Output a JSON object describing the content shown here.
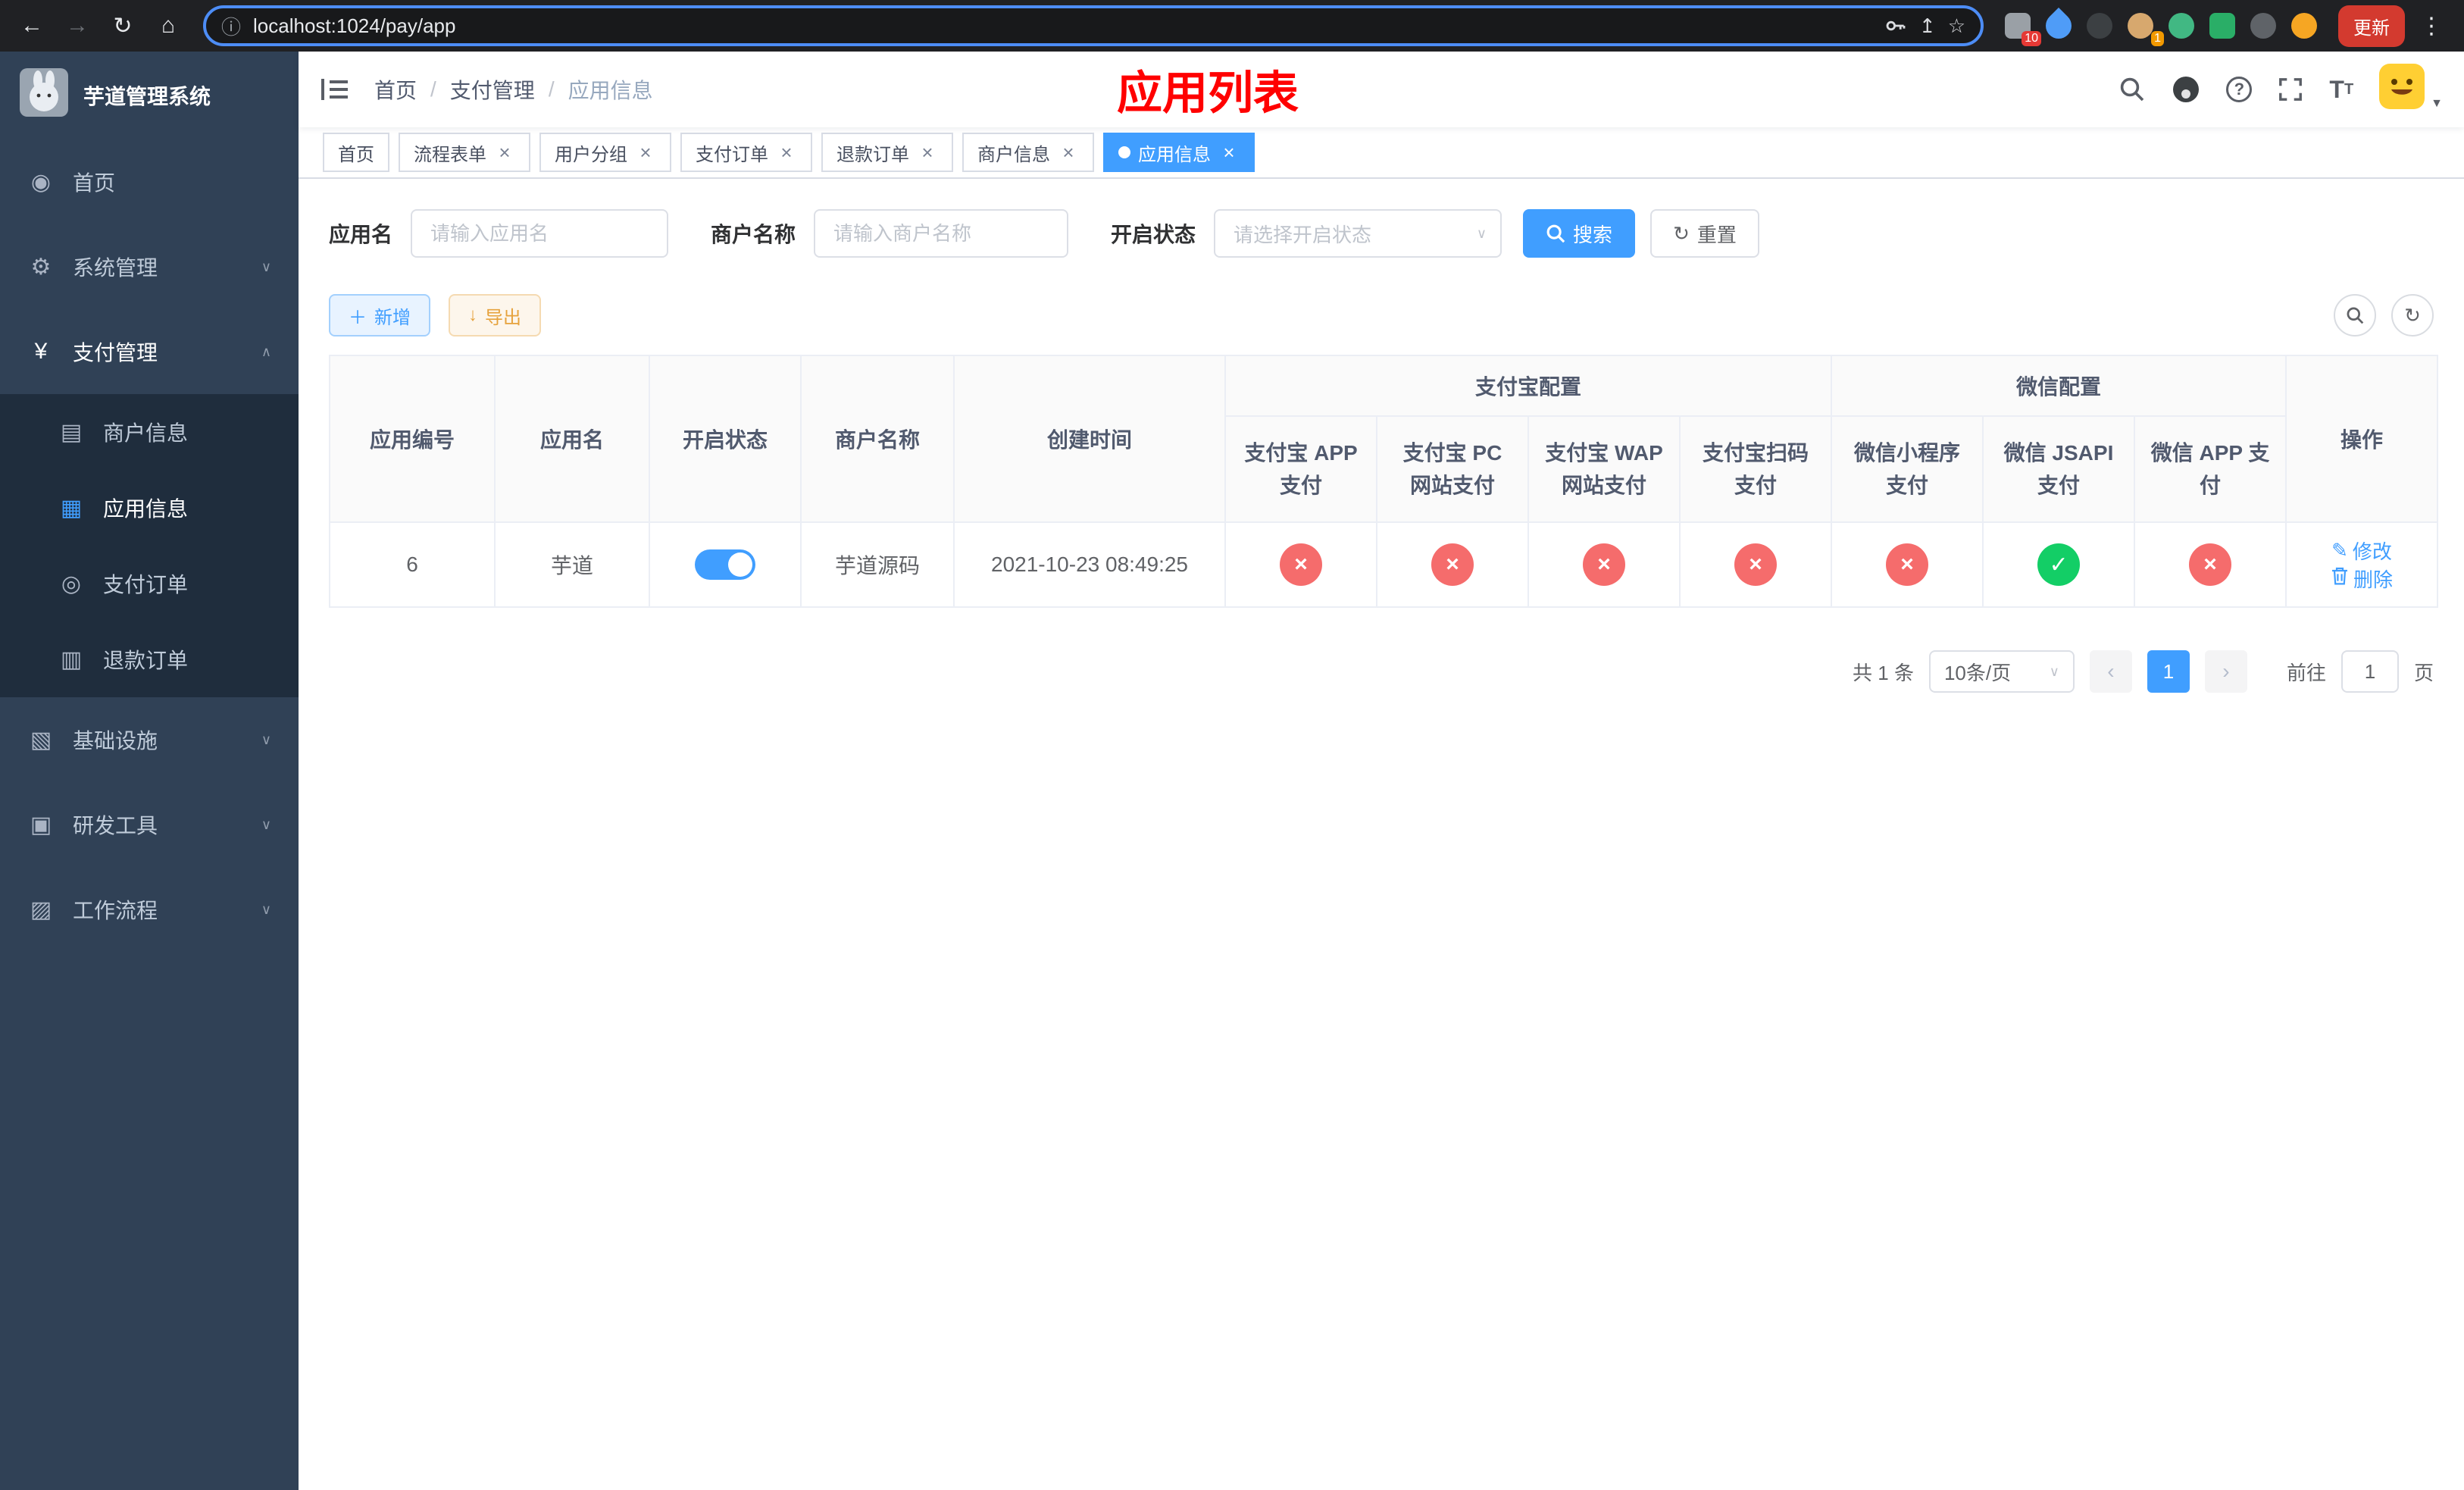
{
  "colors": {
    "accent": "#409eff",
    "danger": "#f56c6c",
    "success": "#13ce66",
    "warning": "#e6a23c",
    "sidebar-bg": "#304156",
    "submenu-bg": "#1f2d3d",
    "sidebar-text": "#bfcbd9",
    "update-red": "#d33a2f",
    "title-red": "#ff0000"
  },
  "icons": {
    "cross": "×",
    "check": "✓",
    "edit": "✎",
    "chevron_down": "∨",
    "chevron_up": "∧"
  },
  "browser": {
    "url": "localhost:1024/pay/app",
    "update_label": "更新",
    "extensions": [
      {
        "name": "grid-extension-icon",
        "shape": "square",
        "color": "#9aa0a6",
        "badge": "10",
        "badgeColor": "#e53935"
      },
      {
        "name": "drop-extension-icon",
        "shape": "drop",
        "color": "#4f9cf7"
      },
      {
        "name": "dark-extension-icon",
        "shape": "circle",
        "color": "#3c4043"
      },
      {
        "name": "avatar-extension-icon",
        "shape": "circle",
        "color": "#d7a86e",
        "badge": "1",
        "badgeColor": "#f29900"
      },
      {
        "name": "vue-devtools-icon",
        "shape": "circle",
        "color": "#41b883"
      },
      {
        "name": "chat-extension-icon",
        "shape": "square",
        "color": "#2aae67"
      },
      {
        "name": "puzzle-extension-icon",
        "shape": "circle",
        "color": "#5f6368"
      },
      {
        "name": "emoji-extension-icon",
        "shape": "circle",
        "color": "#f6a623"
      }
    ]
  },
  "sidebar": {
    "title": "芋道管理系统",
    "items": [
      {
        "key": "home",
        "label": "首页",
        "icon": "dashboard-icon",
        "glyph": "◉",
        "type": "top"
      },
      {
        "key": "system",
        "label": "系统管理",
        "icon": "gear-icon",
        "glyph": "⚙",
        "type": "top",
        "chevron": "down"
      },
      {
        "key": "payment",
        "label": "支付管理",
        "icon": "yen-icon",
        "glyph": "¥",
        "type": "top",
        "chevron": "up",
        "active_parent": true
      },
      {
        "key": "merchant-info",
        "label": "商户信息",
        "icon": "card-icon",
        "glyph": "▤",
        "type": "sub"
      },
      {
        "key": "app-info",
        "label": "应用信息",
        "icon": "grid-icon",
        "glyph": "▦",
        "type": "sub",
        "active": true
      },
      {
        "key": "pay-order",
        "label": "支付订单",
        "icon": "order-icon",
        "glyph": "◎",
        "type": "sub"
      },
      {
        "key": "refund-order",
        "label": "退款订单",
        "icon": "doc-icon",
        "glyph": "▥",
        "type": "sub"
      },
      {
        "key": "infrastructure",
        "label": "基础设施",
        "icon": "server-icon",
        "glyph": "▧",
        "type": "top",
        "chevron": "down"
      },
      {
        "key": "dev-tools",
        "label": "研发工具",
        "icon": "toolbox-icon",
        "glyph": "▣",
        "type": "top",
        "chevron": "down"
      },
      {
        "key": "workflow",
        "label": "工作流程",
        "icon": "workflow-icon",
        "glyph": "▨",
        "type": "top",
        "chevron": "down"
      }
    ]
  },
  "header": {
    "breadcrumb": [
      "首页",
      "支付管理",
      "应用信息"
    ],
    "title": "应用列表"
  },
  "tabs": [
    {
      "label": "首页",
      "closable": false,
      "active": false
    },
    {
      "label": "流程表单",
      "closable": true,
      "active": false
    },
    {
      "label": "用户分组",
      "closable": true,
      "active": false
    },
    {
      "label": "支付订单",
      "closable": true,
      "active": false
    },
    {
      "label": "退款订单",
      "closable": true,
      "active": false
    },
    {
      "label": "商户信息",
      "closable": true,
      "active": false
    },
    {
      "label": "应用信息",
      "closable": true,
      "active": true
    }
  ],
  "filters": {
    "app_name_label": "应用名",
    "app_name_placeholder": "请输入应用名",
    "merchant_label": "商户名称",
    "merchant_placeholder": "请输入商户名称",
    "status_label": "开启状态",
    "status_placeholder": "请选择开启状态",
    "search_label": "搜索",
    "reset_label": "重置"
  },
  "toolbar": {
    "add_label": "新增",
    "export_label": "导出"
  },
  "table": {
    "simple_columns": [
      "应用编号",
      "应用名",
      "开启状态",
      "商户名称",
      "创建时间"
    ],
    "groups": [
      {
        "label": "支付宝配置",
        "children": [
          "支付宝 APP 支付",
          "支付宝 PC 网站支付",
          "支付宝 WAP 网站支付",
          "支付宝扫码支付"
        ]
      },
      {
        "label": "微信配置",
        "children": [
          "微信小程序支付",
          "微信 JSAPI 支付",
          "微信 APP 支付"
        ]
      }
    ],
    "action_column": "操作",
    "rows": [
      {
        "id": "6",
        "name": "芋道",
        "enabled": true,
        "merchant": "芋道源码",
        "created_at": "2021-10-23 08:49:25",
        "channels": [
          false,
          false,
          false,
          false,
          false,
          true,
          false
        ],
        "edit_label": "修改",
        "delete_label": "删除"
      }
    ]
  },
  "pagination": {
    "total_text": "共 1 条",
    "page_size": "10条/页",
    "pages": [
      "1"
    ],
    "current": "1",
    "goto_label": "前往",
    "goto_value": "1",
    "page_unit": "页"
  }
}
